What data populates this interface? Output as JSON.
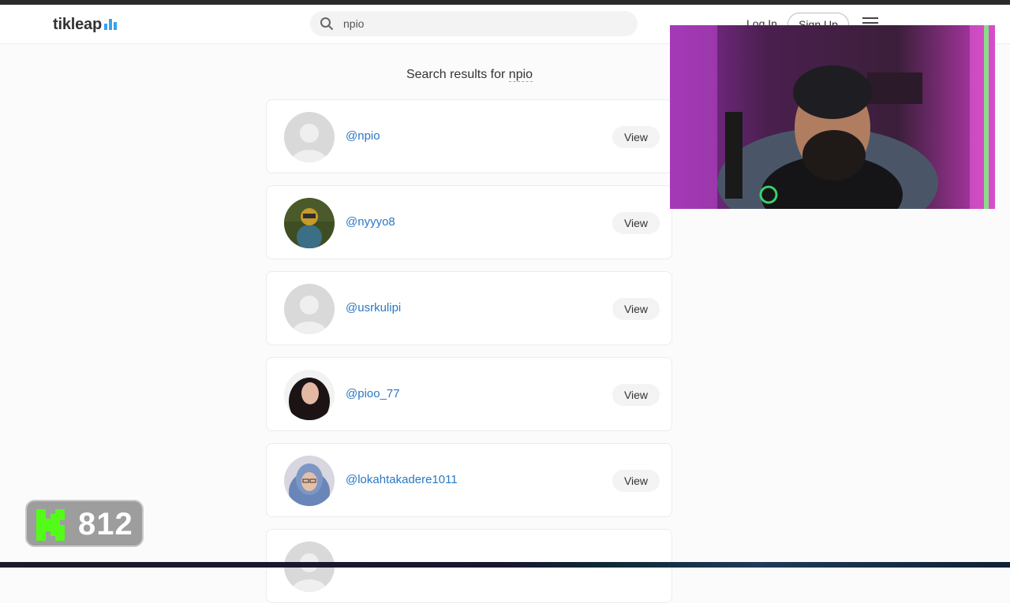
{
  "header": {
    "logo_text": "tikleap",
    "search_value": "npio",
    "login_label": "Log In",
    "signup_label": "Sign Up",
    "brand_color": "#3aa0ea"
  },
  "results": {
    "title_prefix": "Search results for",
    "query": "npio",
    "view_label": "View",
    "items": [
      {
        "username": "@npio",
        "avatar": "default"
      },
      {
        "username": "@nyyyo8",
        "avatar": "photo"
      },
      {
        "username": "@usrkulipi",
        "avatar": "default"
      },
      {
        "username": "@pioo_77",
        "avatar": "photo"
      },
      {
        "username": "@lokahtakadere1011",
        "avatar": "photo"
      },
      {
        "username": "",
        "avatar": "default"
      }
    ]
  },
  "overlay": {
    "counter_value": "812",
    "counter_icon": "kick-logo-icon",
    "counter_icon_color": "#53fc18"
  }
}
